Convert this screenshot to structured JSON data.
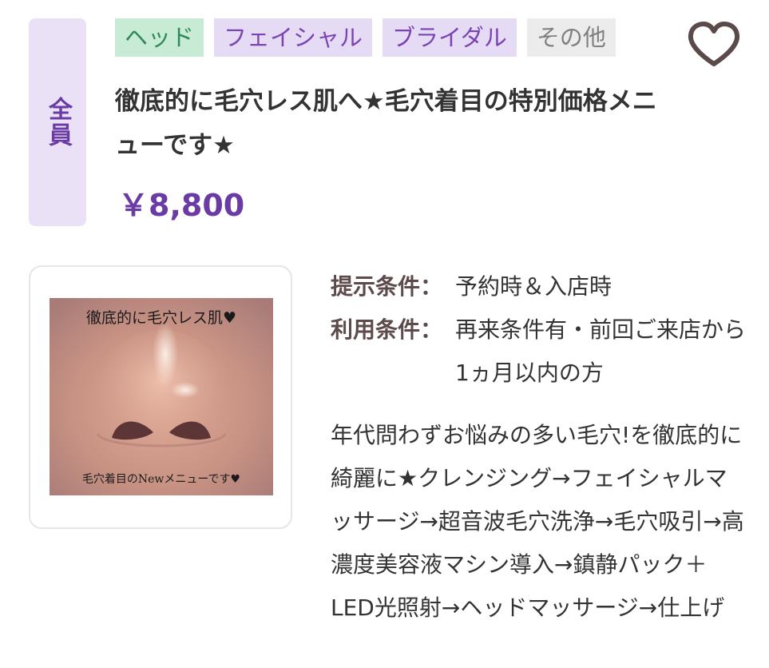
{
  "audience": "全員",
  "tags": [
    "ヘッド",
    "フェイシャル",
    "ブライダル",
    "その他"
  ],
  "title": "徹底的に毛穴レス肌へ★毛穴着目の特別価格メニューです★",
  "price": "￥8,800",
  "image": {
    "caption_top": "徹底的に毛穴レス肌♥",
    "caption_bottom": "毛穴着目のNewメニューです♥"
  },
  "conditions": {
    "presentation_label": "提示条件：",
    "presentation_value": "予約時＆入店時",
    "usage_label": "利用条件：",
    "usage_value": "再来条件有・前回ご来店から1ヵ月以内の方"
  },
  "description": "年代問わずお悩みの多い毛穴!を徹底的に綺麗に★クレンジング→フェイシャルマッサージ→超音波毛穴洗浄→毛穴吸引→高濃度美容液マシン導入→鎮静パック＋LED光照射→ヘッドマッサージ→仕上げ",
  "colors": {
    "accent": "#6a3aa5",
    "audience_bg": "#ebe1f7",
    "tag_head_bg": "#c8ebd6",
    "tag_purple_bg": "#e6dbf4",
    "tag_other_bg": "#ececec"
  },
  "icons": {
    "favorite": "heart-outline-icon"
  }
}
